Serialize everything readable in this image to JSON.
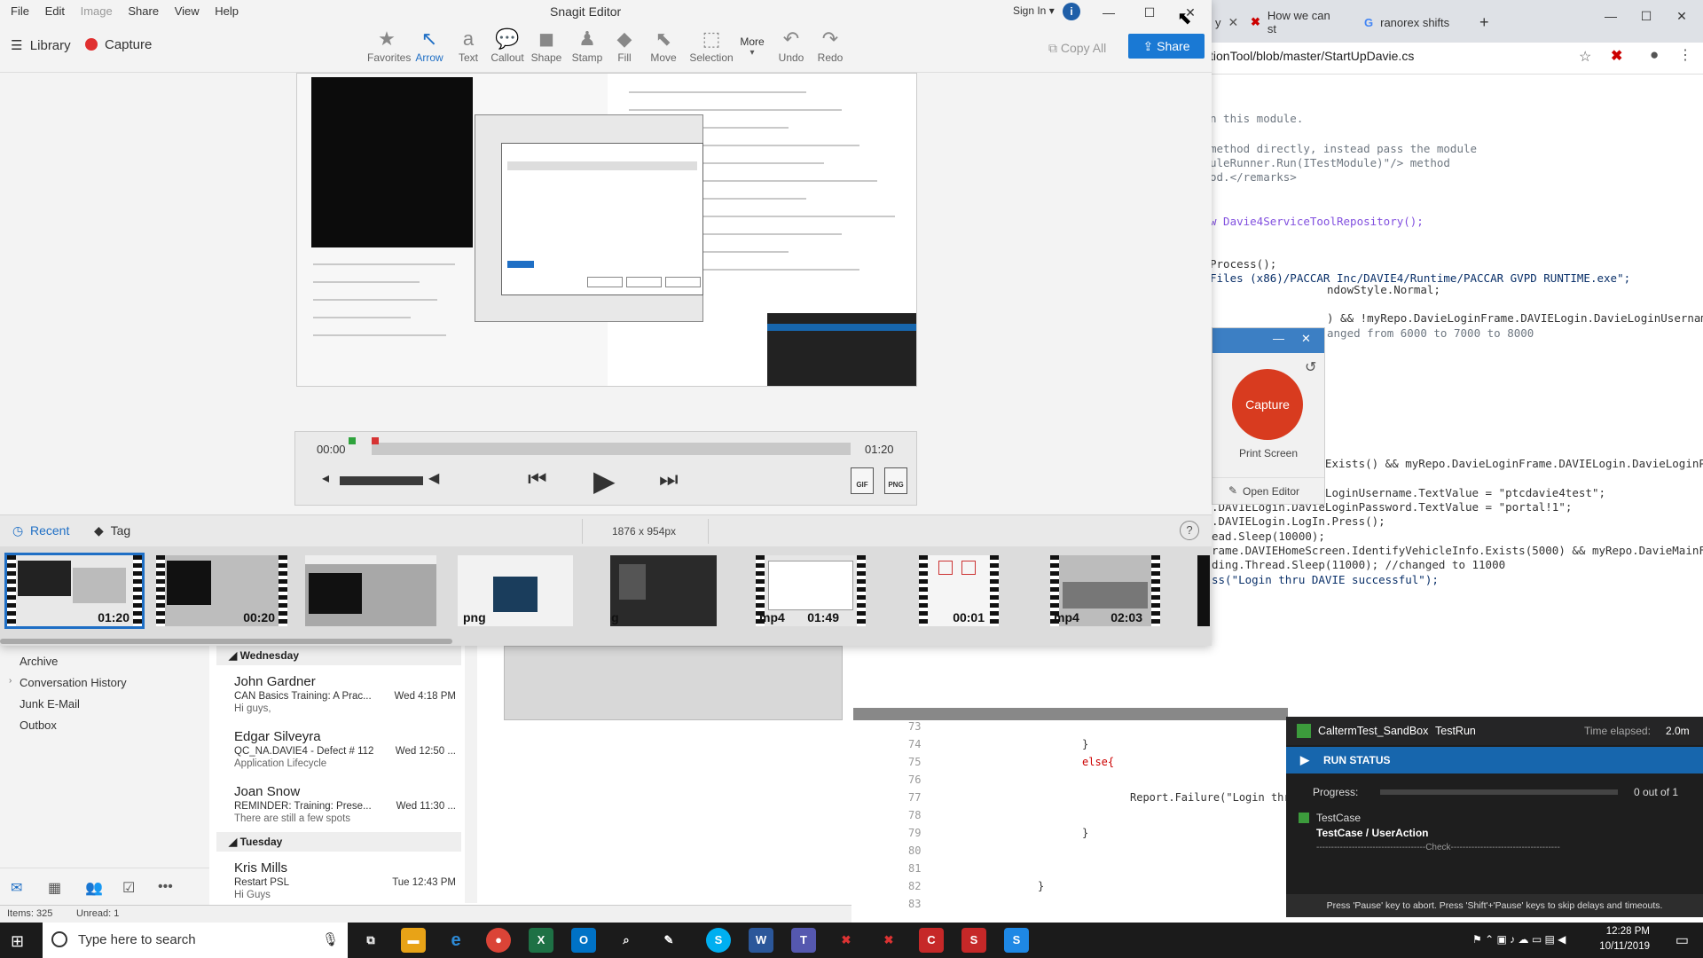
{
  "browser": {
    "tabs": [
      {
        "label": "y"
      },
      {
        "label": "How we can st"
      },
      {
        "label": "ranorex shifts"
      }
    ],
    "url": "tionTool/blob/master/StartUpDavie.cs",
    "code_lines": [
      "n this module.",
      "method directly, instead pass the module",
      "uleRunner.Run(ITestModule)\"/> method",
      "od.</remarks>",
      "w Davie4ServiceToolRepository();",
      "Process();",
      "Files (x86)/PACCAR Inc/DAVIE4/Runtime/PACCAR GVPD RUNTIME.exe\";",
      "ndowStyle.Normal;",
      ") && !myRepo.DavieLoginFrame.DAVIELogin.DavieLoginUsernameInfo",
      "anged from 6000 to 7000 to 8000",
      "ELogin.LogInInfo.Exists() && myRepo.DavieLoginFrame.DAVIELogin.DavieLoginPassword",
      ".DAVIELogin.DavieLoginUsername.TextValue = \"ptcdavie4test\";",
      ".DAVIELogin.DavieLoginPassword.TextValue = \"portal!1\";",
      ".DAVIELogin.LogIn.Press();",
      "ead.Sleep(10000);",
      "rame.DAVIEHomeScreen.IdentifyVehicleInfo.Exists(5000) && myRepo.DavieMainFrame.DAVI",
      "ding.Thread.Sleep(11000); //changed to 11000",
      "ss(\"Login thru DAVIE successful\");"
    ]
  },
  "capture_mini": {
    "capture_label": "Capture",
    "print_screen": "Print Screen",
    "open_editor": "Open Editor"
  },
  "editor2": {
    "line_numbers": [
      "73",
      "74",
      "75",
      "76",
      "77",
      "78",
      "79",
      "80",
      "81",
      "82",
      "83"
    ],
    "lines": [
      "}",
      "else{",
      "Report.Failure(\"Login thru",
      "}",
      "}"
    ]
  },
  "ranorex": {
    "sandbox": "CaltermTest_SandBox",
    "testrun": "TestRun",
    "elapsed_label": "Time elapsed:",
    "elapsed_value": "2.0m",
    "run_status": "RUN STATUS",
    "progress_label": "Progress:",
    "progress_value": "0 out of 1",
    "testcase": "TestCase",
    "testcase_path": "TestCase / UserAction",
    "check": "-------------------------------------Check-------------------------------------",
    "footer": "Press 'Pause' key to abort. Press 'Shift'+'Pause' keys to skip delays and timeouts."
  },
  "outlook": {
    "folders": [
      "Archive",
      "Conversation History",
      "Junk E-Mail",
      "Outbox"
    ],
    "groups": [
      "Wednesday",
      "Tuesday"
    ],
    "mails": [
      {
        "from": "John Gardner",
        "subject": "CAN Basics Training: A Prac...",
        "time": "Wed 4:18 PM",
        "preview": "Hi guys,"
      },
      {
        "from": "Edgar Silveyra",
        "subject": "QC_NA.DAVIE4 - Defect # 112",
        "time": "Wed 12:50 ...",
        "preview": "Application Lifecycle"
      },
      {
        "from": "Joan Snow",
        "subject": "REMINDER: Training: Prese...",
        "time": "Wed 11:30 ...",
        "preview": "There are still a few spots"
      },
      {
        "from": "Kris Mills",
        "subject": "Restart PSL",
        "time": "Tue 12:43 PM",
        "preview": "Hi Guys"
      }
    ],
    "items": "Items: 325",
    "unread": "Unread: 1"
  },
  "snagit": {
    "menu": [
      "File",
      "Edit",
      "Image",
      "Share",
      "View",
      "Help"
    ],
    "title": "Snagit Editor",
    "signin": "Sign In ▾",
    "library": "Library",
    "capture": "Capture",
    "tools": [
      {
        "label": "Favorites",
        "icon": "star-icon"
      },
      {
        "label": "Arrow",
        "icon": "arrow-icon"
      },
      {
        "label": "Text",
        "icon": "text-icon"
      },
      {
        "label": "Callout",
        "icon": "callout-icon"
      },
      {
        "label": "Shape",
        "icon": "shape-icon"
      },
      {
        "label": "Stamp",
        "icon": "stamp-icon"
      },
      {
        "label": "Fill",
        "icon": "fill-icon"
      },
      {
        "label": "Move",
        "icon": "move-icon"
      },
      {
        "label": "Selection",
        "icon": "selection-icon"
      },
      {
        "label": "More",
        "icon": "more-icon"
      },
      {
        "label": "Undo",
        "icon": "undo-icon"
      },
      {
        "label": "Redo",
        "icon": "redo-icon"
      }
    ],
    "copy_all": "Copy All",
    "share": "Share",
    "player": {
      "start": "00:00",
      "end": "01:20",
      "export_gif": "GIF",
      "export_png": "PNG"
    },
    "tray": {
      "recent": "Recent",
      "tag": "Tag",
      "dims": "1876 x 954px",
      "help": "?"
    },
    "thumbnails": [
      {
        "label": "01:20",
        "left_label": ""
      },
      {
        "label": "00:20",
        "left_label": ""
      },
      {
        "label": "",
        "left_label": ""
      },
      {
        "label": "",
        "left_label": "png"
      },
      {
        "label": "",
        "left_label": "png"
      },
      {
        "label": "01:49",
        "left_label": "mp4"
      },
      {
        "label": "00:01",
        "left_label": ""
      },
      {
        "label": "02:03",
        "left_label": "mp4"
      }
    ]
  },
  "taskbar": {
    "search_placeholder": "Type here to search",
    "time": "12:28 PM",
    "date": "10/11/2019"
  }
}
